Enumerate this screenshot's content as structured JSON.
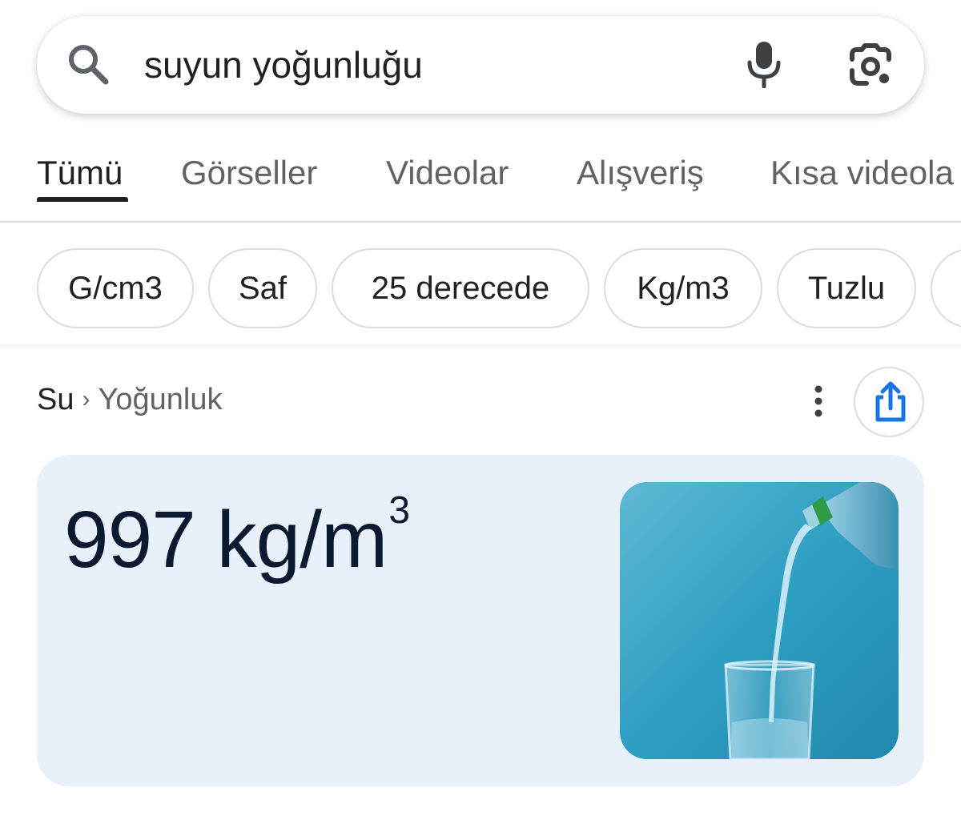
{
  "search": {
    "query": "suyun yoğunluğu",
    "icons": {
      "search": "search-icon",
      "mic": "mic-icon",
      "lens": "google-lens-icon"
    }
  },
  "tabs": [
    {
      "label": "Tümü",
      "active": true
    },
    {
      "label": "Görseller",
      "active": false
    },
    {
      "label": "Videolar",
      "active": false
    },
    {
      "label": "Alışveriş",
      "active": false
    },
    {
      "label": "Kısa videola",
      "active": false
    }
  ],
  "chips": [
    "G/cm3",
    "Saf",
    "25 derecede",
    "Kg/m3",
    "Tuzlu"
  ],
  "breadcrumb": {
    "parent": "Su",
    "separator": "›",
    "current": "Yoğunluk"
  },
  "answer": {
    "value": "997 kg/m",
    "superscript": "3"
  },
  "colors": {
    "accent": "#1a73e8",
    "card_bg": "#e8f0fa",
    "text": "#202124",
    "muted": "#5f6368"
  }
}
